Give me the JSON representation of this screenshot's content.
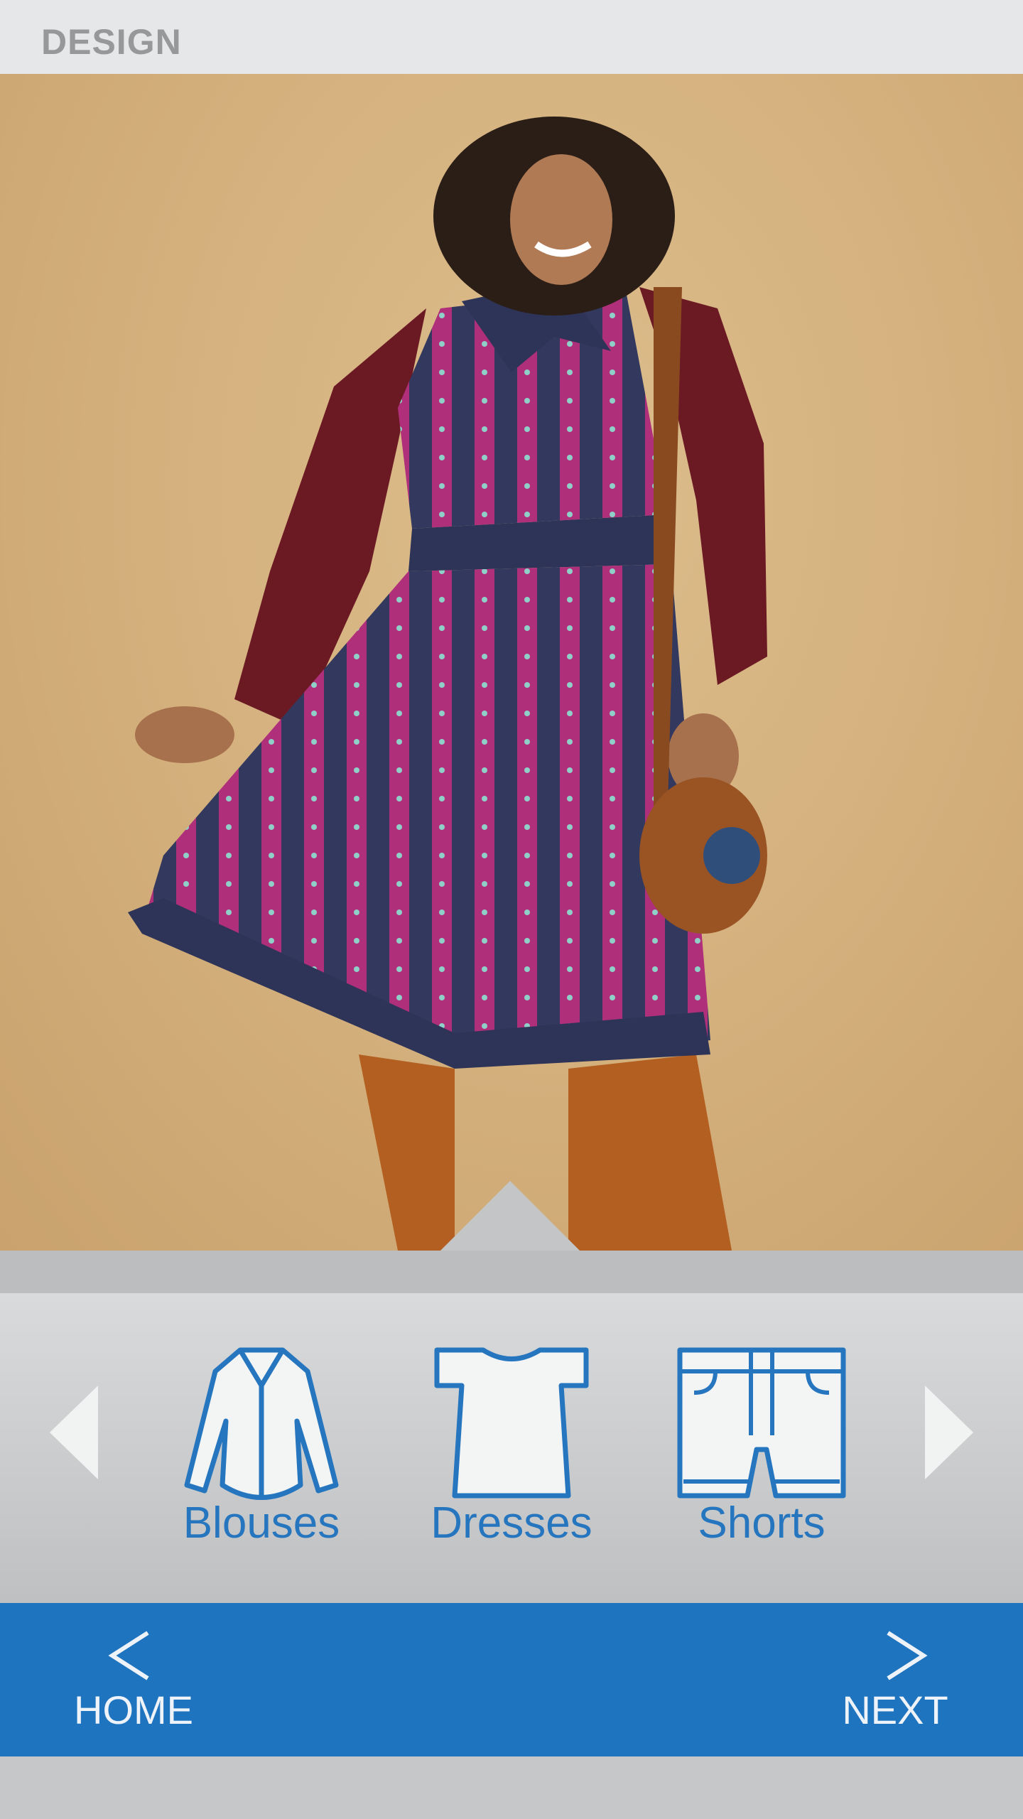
{
  "header": {
    "title": "DESIGN"
  },
  "hero": {
    "alt": "model-photo"
  },
  "categories": [
    {
      "label": "Blouses",
      "icon": "blouse-icon"
    },
    {
      "label": "Dresses",
      "icon": "dress-icon"
    },
    {
      "label": "Shorts",
      "icon": "shorts-icon"
    }
  ],
  "nav": {
    "home_label": "HOME",
    "next_label": "NEXT"
  },
  "colors": {
    "accent": "#1f74bf",
    "icon_stroke": "#2676bf",
    "header_bg": "#e6e7e9"
  }
}
